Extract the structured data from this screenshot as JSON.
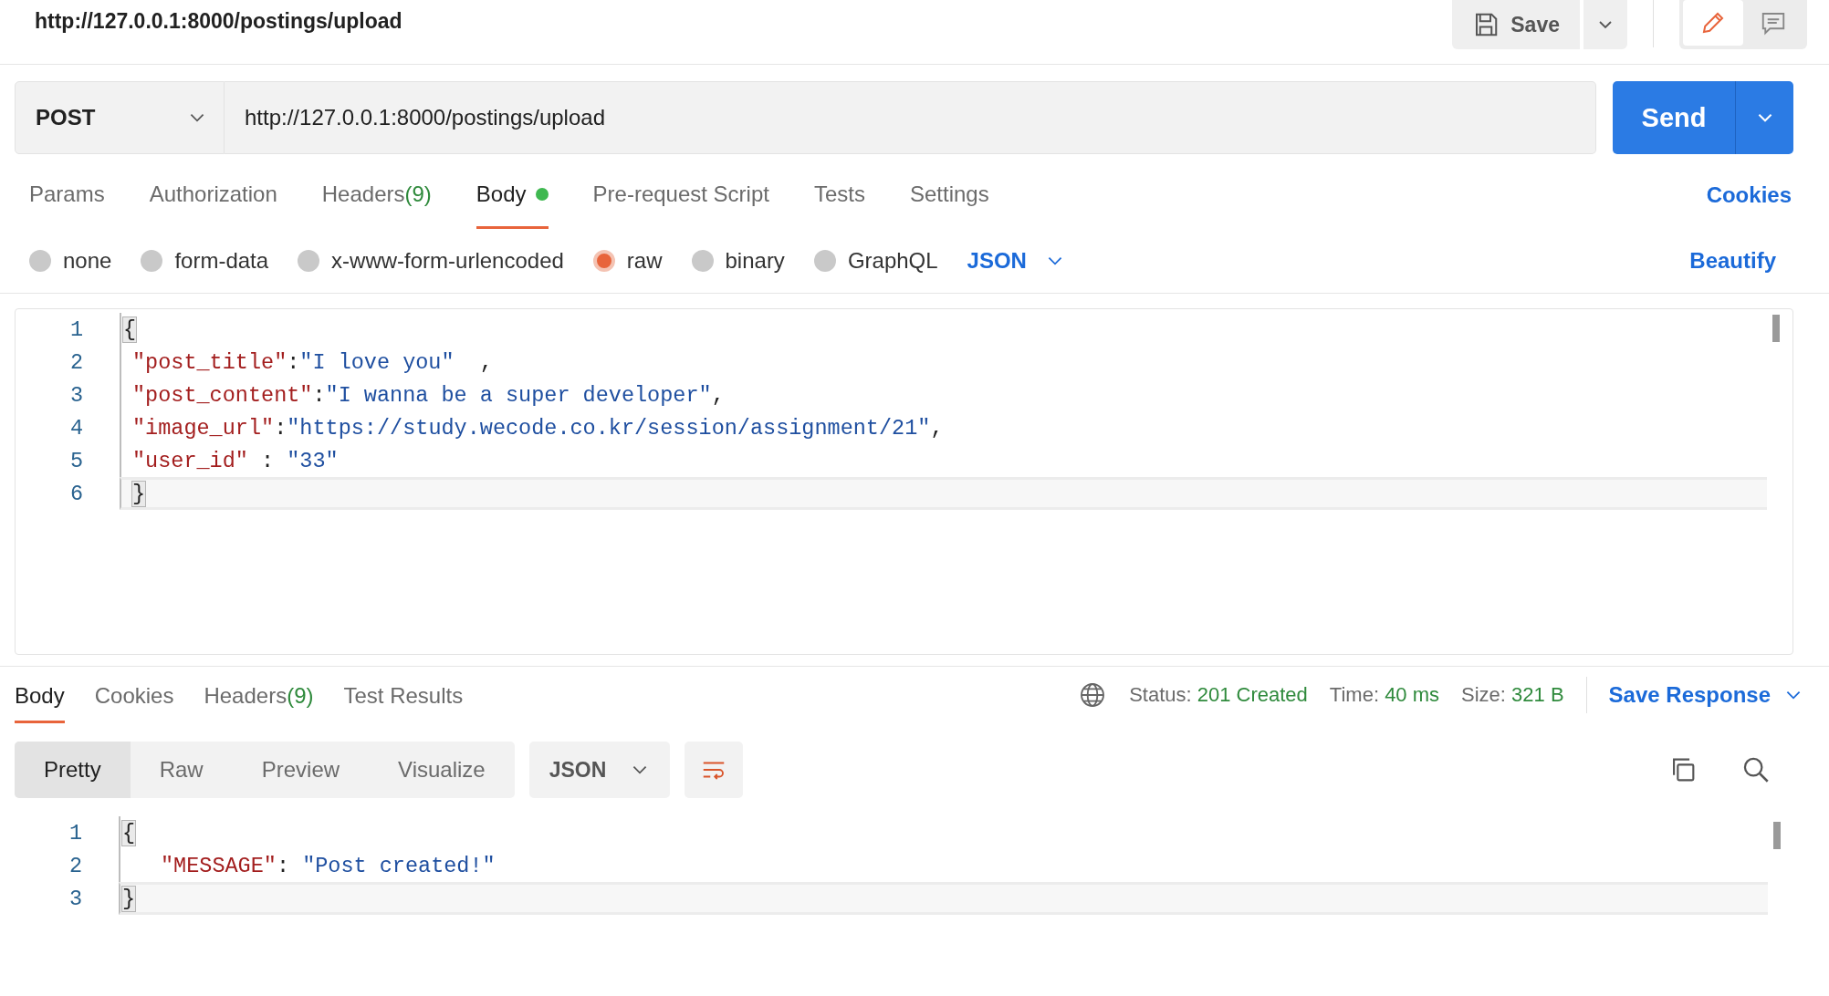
{
  "header": {
    "title": "http://127.0.0.1:8000/postings/upload",
    "save_label": "Save",
    "modes": [
      {
        "selected": true
      },
      {
        "selected": false
      }
    ]
  },
  "request": {
    "method": "POST",
    "url": "http://127.0.0.1:8000/postings/upload",
    "send_label": "Send"
  },
  "request_tabs": [
    {
      "label": "Params",
      "selected": false
    },
    {
      "label": "Authorization",
      "selected": false
    },
    {
      "label": "Headers",
      "count": "(9)",
      "selected": false
    },
    {
      "label": "Body",
      "indicator": true,
      "selected": true
    },
    {
      "label": "Pre-request Script",
      "selected": false
    },
    {
      "label": "Tests",
      "selected": false
    },
    {
      "label": "Settings",
      "selected": false
    }
  ],
  "cookies_link": "Cookies",
  "body_types": [
    {
      "label": "none",
      "selected": false
    },
    {
      "label": "form-data",
      "selected": false
    },
    {
      "label": "x-www-form-urlencoded",
      "selected": false
    },
    {
      "label": "raw",
      "selected": true
    },
    {
      "label": "binary",
      "selected": false
    },
    {
      "label": "GraphQL",
      "selected": false
    }
  ],
  "body_format": "JSON",
  "beautify_link": "Beautify",
  "request_editor": {
    "lines": [
      {
        "number": "1",
        "active": false,
        "tokens": [
          {
            "kind": "bracket",
            "text": "{"
          }
        ]
      },
      {
        "number": "2",
        "active": false,
        "tokens": [
          {
            "kind": "key",
            "text": "\"post_title\""
          },
          {
            "kind": "plain",
            "text": ":"
          },
          {
            "kind": "string",
            "text": "\"I love you\""
          },
          {
            "kind": "plain",
            "text": "  ,"
          }
        ]
      },
      {
        "number": "3",
        "active": false,
        "tokens": [
          {
            "kind": "key",
            "text": "\"post_content\""
          },
          {
            "kind": "plain",
            "text": ":"
          },
          {
            "kind": "string",
            "text": "\"I wanna be a super developer\""
          },
          {
            "kind": "plain",
            "text": ","
          }
        ]
      },
      {
        "number": "4",
        "active": false,
        "tokens": [
          {
            "kind": "key",
            "text": "\"image_url\""
          },
          {
            "kind": "plain",
            "text": ":"
          },
          {
            "kind": "string",
            "text": "\"https://study.wecode.co.kr/session/assignment/21\""
          },
          {
            "kind": "plain",
            "text": ","
          }
        ]
      },
      {
        "number": "5",
        "active": false,
        "tokens": [
          {
            "kind": "key",
            "text": "\"user_id\""
          },
          {
            "kind": "plain",
            "text": " : "
          },
          {
            "kind": "string",
            "text": "\"33\""
          }
        ]
      },
      {
        "number": "6",
        "active": true,
        "tokens": [
          {
            "kind": "bracket",
            "text": "}"
          }
        ]
      }
    ]
  },
  "response_tabs": [
    {
      "label": "Body",
      "selected": true
    },
    {
      "label": "Cookies",
      "selected": false
    },
    {
      "label": "Headers",
      "count": "(9)",
      "selected": false
    },
    {
      "label": "Test Results",
      "selected": false
    }
  ],
  "response_stats": [
    {
      "label": "Status:",
      "value": "201 Created"
    },
    {
      "label": "Time:",
      "value": "40 ms"
    },
    {
      "label": "Size:",
      "value": "321 B"
    }
  ],
  "save_response_label": "Save Response",
  "view_modes": [
    {
      "label": "Pretty",
      "selected": true
    },
    {
      "label": "Raw",
      "selected": false
    },
    {
      "label": "Preview",
      "selected": false
    },
    {
      "label": "Visualize",
      "selected": false
    }
  ],
  "response_format": "JSON",
  "response_editor": {
    "lines": [
      {
        "number": "1",
        "active": false,
        "tokens": [
          {
            "kind": "bracket",
            "text": "{"
          }
        ]
      },
      {
        "number": "2",
        "active": false,
        "indented": true,
        "tokens": [
          {
            "kind": "key",
            "text": "\"MESSAGE\""
          },
          {
            "kind": "plain",
            "text": ": "
          },
          {
            "kind": "string",
            "text": "\"Post created!\""
          }
        ]
      },
      {
        "number": "3",
        "active": true,
        "tokens": [
          {
            "kind": "bracket",
            "text": "}"
          }
        ]
      }
    ]
  }
}
